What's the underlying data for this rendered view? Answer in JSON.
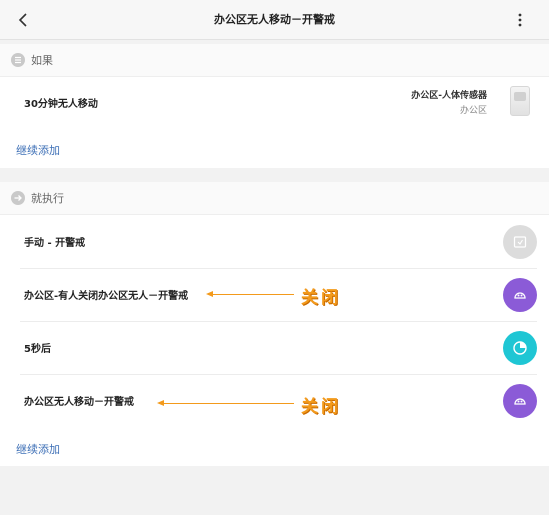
{
  "header": {
    "title": "办公区无人移动－开警戒"
  },
  "if_section": {
    "label": "如果",
    "condition": {
      "label": "30分钟无人移动",
      "device_name": "办公区-人体传感器",
      "device_room": "办公区"
    },
    "add_label": "继续添加"
  },
  "then_section": {
    "label": "就执行",
    "actions": [
      {
        "label": "手动 - 开警戒",
        "icon": "scene-icon"
      },
      {
        "label": "办公区-有人关闭办公区无人－开警戒",
        "icon": "gateway-icon"
      },
      {
        "label": "5秒后",
        "icon": "timer-icon"
      },
      {
        "label": "办公区无人移动－开警戒",
        "icon": "gateway-icon"
      }
    ],
    "add_label": "继续添加"
  },
  "annotations": [
    {
      "text": "关闭"
    },
    {
      "text": "关闭"
    }
  ],
  "colors": {
    "accent_link": "#3d6fb6",
    "annotation": "#f39a1b",
    "purple": "#8b5bd7",
    "teal": "#1fc6d4"
  }
}
